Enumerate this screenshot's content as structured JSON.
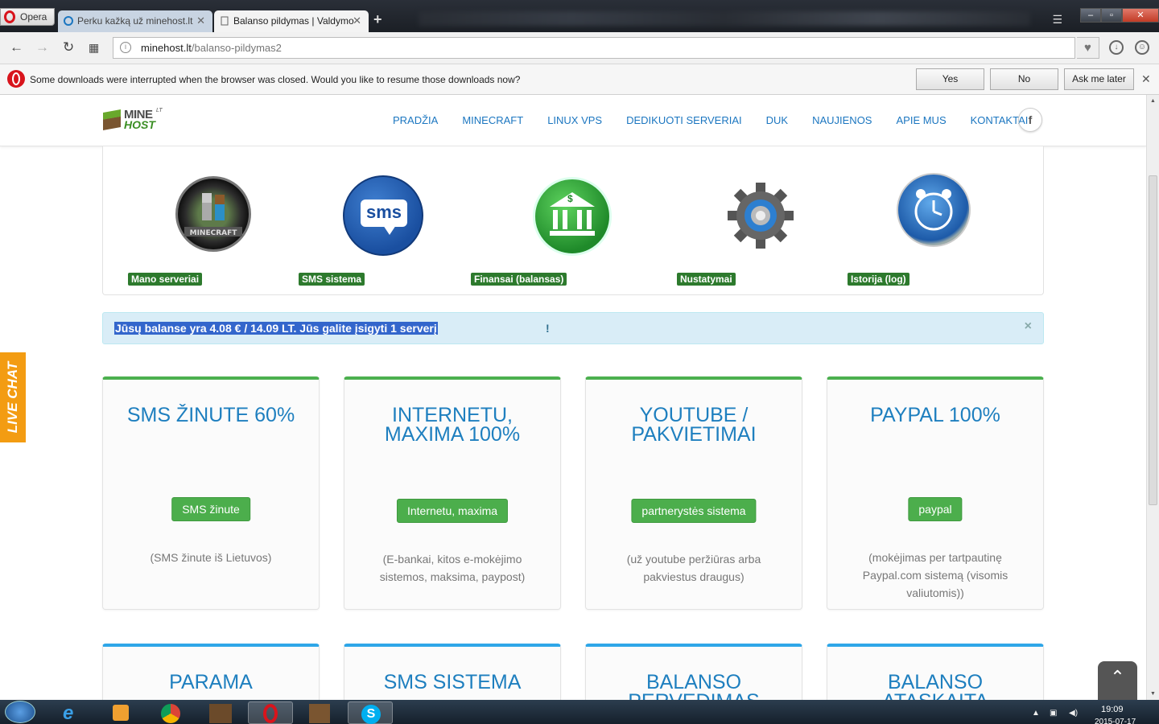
{
  "browser": {
    "menu_label": "Opera",
    "tabs": [
      {
        "title": "Perku kažką už minehost.lt",
        "active": false
      },
      {
        "title": "Balanso pildymas | Valdymo",
        "active": true
      }
    ],
    "address": {
      "domain": "minehost.lt",
      "path": "/balanso-pildymas2"
    },
    "notification": {
      "message": "Some downloads were interrupted when the browser was closed. Would you like to resume those downloads now?",
      "yes_label": "Yes",
      "no_label": "No",
      "later_label": "Ask me later"
    }
  },
  "site": {
    "logo": {
      "line1": "MINE",
      "line2": "HOST",
      "suffix": "LT"
    },
    "nav": [
      "PRADŽIA",
      "MINECRAFT",
      "LINUX VPS",
      "DEDIKUOTI SERVERIAI",
      "DUK",
      "NAUJIENOS",
      "APIE MUS",
      "KONTAKTAI"
    ],
    "facebook_label": "f",
    "icons": [
      {
        "label": "Mano serveriai",
        "icon": "minecraft-icon"
      },
      {
        "label": "SMS sistema",
        "icon": "sms-icon",
        "glyph": "sms"
      },
      {
        "label": "Finansai (balansas)",
        "icon": "bank-icon",
        "glyph": "$"
      },
      {
        "label": "Nustatymai",
        "icon": "gear-icon"
      },
      {
        "label": "Istorija (log)",
        "icon": "clock-icon"
      }
    ],
    "alert": {
      "highlighted": "Jūsų balanse yra 4.08 € / 14.09 LT. Jūs galite įsigyti 1 serverį",
      "suffix": " !",
      "close": "×"
    },
    "cards_row1": [
      {
        "title": "SMS ŽINUTE 60%",
        "button": "SMS žinute",
        "description": "(SMS žinute iš Lietuvos)"
      },
      {
        "title": "INTERNETU, MAXIMA 100%",
        "button": "Internetu, maxima",
        "description": "(E-bankai, kitos e-mokėjimo sistemos, maksima, paypost)"
      },
      {
        "title": "YOUTUBE / PAKVIETIMAI",
        "button": "partnerystės sistema",
        "description": "(už youtube peržiūras arba pakviestus draugus)"
      },
      {
        "title": "PAYPAL 100%",
        "button": "paypal",
        "description": "(mokėjimas per tartpautinę Paypal.com sistemą (visomis valiutomis))"
      }
    ],
    "cards_row2": [
      {
        "title": "PARAMA"
      },
      {
        "title": "SMS SISTEMA"
      },
      {
        "title": "BALANSO PERVEDIMAS"
      },
      {
        "title": "BALANSO ATASKAITA"
      }
    ],
    "live_chat": "LIVE CHAT",
    "back_to_top": "⌃"
  },
  "taskbar": {
    "time": "19:09",
    "date": "2015-07-17"
  },
  "colors": {
    "nav_blue": "#1b76c0",
    "green": "#4cae4c",
    "alert_bg": "#d9edf7",
    "live_chat": "#f39c12"
  }
}
